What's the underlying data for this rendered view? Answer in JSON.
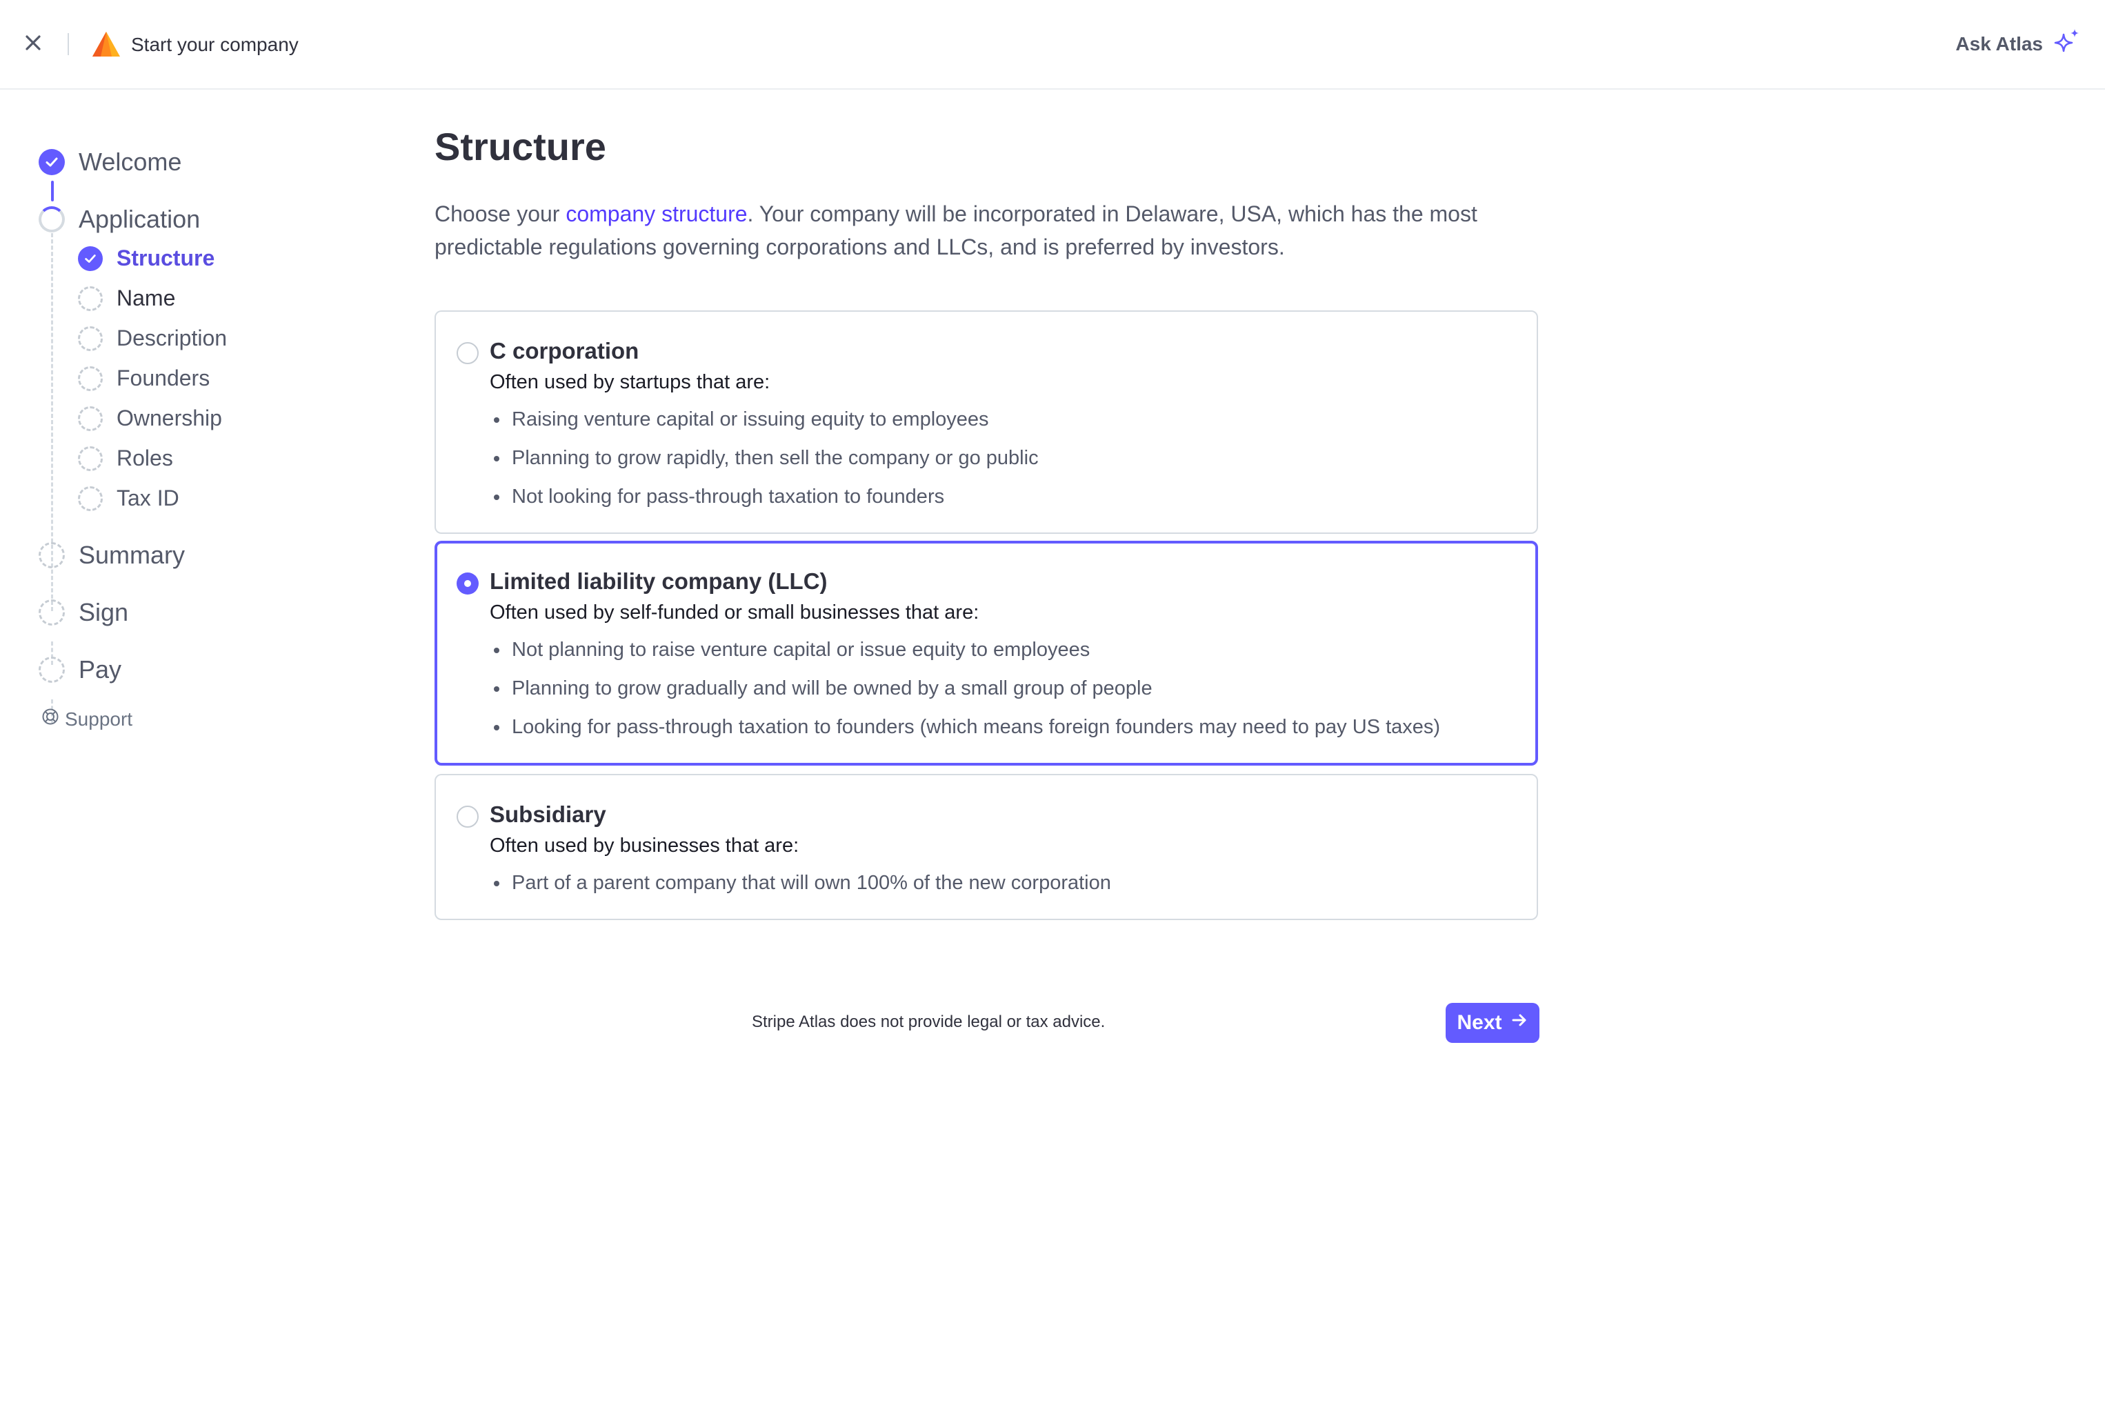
{
  "header": {
    "title": "Start your company",
    "ask_label": "Ask Atlas"
  },
  "sidebar": {
    "steps": [
      {
        "label": "Welcome",
        "state": "complete"
      },
      {
        "label": "Application",
        "state": "in-progress"
      },
      {
        "label": "Summary",
        "state": "pending"
      },
      {
        "label": "Sign",
        "state": "pending"
      },
      {
        "label": "Pay",
        "state": "pending"
      }
    ],
    "substeps": [
      {
        "label": "Structure",
        "state": "complete",
        "current": true
      },
      {
        "label": "Name",
        "state": "pending"
      },
      {
        "label": "Description",
        "state": "pending"
      },
      {
        "label": "Founders",
        "state": "pending"
      },
      {
        "label": "Ownership",
        "state": "pending"
      },
      {
        "label": "Roles",
        "state": "pending"
      },
      {
        "label": "Tax ID",
        "state": "pending"
      }
    ],
    "support_label": "Support"
  },
  "main": {
    "title": "Structure",
    "intro_before": "Choose your ",
    "intro_link": "company structure",
    "intro_after": ". Your company will be incorporated in Delaware, USA, which has the most predictable regulations governing corporations and LLCs, and is preferred by investors.",
    "options": [
      {
        "title": "C corporation",
        "subtitle": "Often used by startups that are:",
        "selected": false,
        "bullets": [
          "Raising venture capital or issuing equity to employees",
          "Planning to grow rapidly, then sell the company or go public",
          "Not looking for pass-through taxation to founders"
        ]
      },
      {
        "title": "Limited liability company (LLC)",
        "subtitle": "Often used by self-funded or small businesses that are:",
        "selected": true,
        "bullets": [
          "Not planning to raise venture capital or issue equity to employees",
          "Planning to grow gradually and will be owned by a small group of people",
          "Looking for pass-through taxation to founders (which means foreign founders may need to pay US taxes)"
        ]
      },
      {
        "title": "Subsidiary",
        "subtitle": "Often used by businesses that are:",
        "selected": false,
        "bullets": [
          "Part of a parent company that will own 100% of the new corporation"
        ]
      }
    ],
    "disclaimer": "Stripe Atlas does not provide legal or tax advice.",
    "next_label": "Next"
  },
  "colors": {
    "accent": "#635bff",
    "link": "#533afd",
    "text": "#30313d",
    "muted": "#545969",
    "border": "#d5dbe1"
  },
  "icons": {
    "close": "close-icon",
    "logo": "atlas-logo-icon",
    "sparkle": "sparkle-icon",
    "support": "lifebuoy-icon",
    "next": "arrow-right-icon"
  }
}
